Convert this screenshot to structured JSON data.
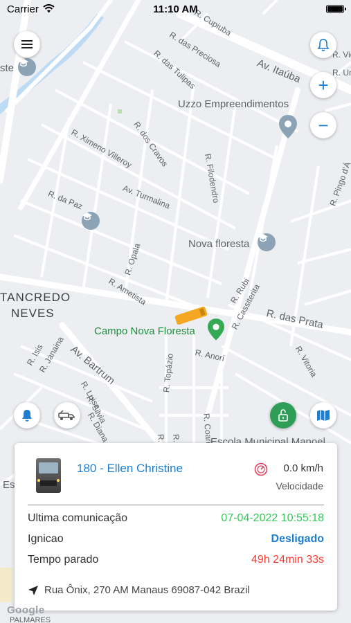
{
  "status_bar": {
    "carrier": "Carrier",
    "time": "11:10 AM"
  },
  "map": {
    "labels": {
      "neighborhood": [
        "TANCREDO",
        "NEVES"
      ],
      "campo": "Campo Nova Floresta",
      "nova_floresta": "Nova floresta",
      "uzzo": "Uzzo Empreendimentos",
      "av_itauba": "Av. Itaúba",
      "r_das_prata": "R. das Prata",
      "av_bartrum": "Av. Bartrum",
      "r_cupiuba": "R. Cupiuba",
      "r_das_preciosa": "R. das Preciosa",
      "r_das_tulipas": "R. das Tulipas",
      "r_ximeno": "R. Ximeno Villeroy",
      "r_dos_cravos": "R. dos Cravos",
      "r_filodendro": "R. Filodendro",
      "av_turmalina": "Av. Turmalina",
      "r_da_paz": "R. da Paz",
      "r_opala": "R. Opala",
      "r_ametista": "R. Ametista",
      "r_rubi": "R. Rubi",
      "r_cassiterita": "R. Cassiterita",
      "r_anori": "R. Anori",
      "r_vitoria": "R. Vitoria",
      "r_topazio": "R. Topázio",
      "r_coari": "R. Coari",
      "r_itacoatiara": "R. Itacoati",
      "r_manaus": "R. Manau",
      "r_isis": "R. Isis",
      "r_janaina": "R. Janaina",
      "r_luisa": "R. Luisa",
      "r_silvia": "R. Silvia",
      "r_diana": "R. Diana",
      "escola": "Escola Municipal Manoel",
      "palmares": "PALMARES",
      "r_vick": "R. Vick",
      "r_un": "R. Un",
      "r_pingo": "R. Pingo d'Á",
      "ste": "ste",
      "es": "Es"
    },
    "google": "Google"
  },
  "buttons": {
    "menu": "menu-icon",
    "bell": "bell-icon",
    "zoom_in": "+",
    "zoom_out": "−"
  },
  "card": {
    "vehicle_name": "180 - Ellen Christine",
    "speed_value": "0.0 km/h",
    "speed_label": "Velocidade",
    "rows": [
      {
        "label": "Ultima comunicação",
        "value": "07-04-2022 10:55:18",
        "color": "#34c759"
      },
      {
        "label": "Ignicao",
        "value": "Desligado",
        "color": "#1e7fd0"
      },
      {
        "label": "Tempo parado",
        "value": "49h 24min 33s",
        "color": "#ff3b30"
      }
    ],
    "address": "Rua Ônix, 270 AM Manaus 69087-042 Brazil"
  },
  "colors": {
    "accent_blue": "#1e7fd0",
    "lock_green": "#2e9e57",
    "vehicle_orange": "#f5a623"
  }
}
